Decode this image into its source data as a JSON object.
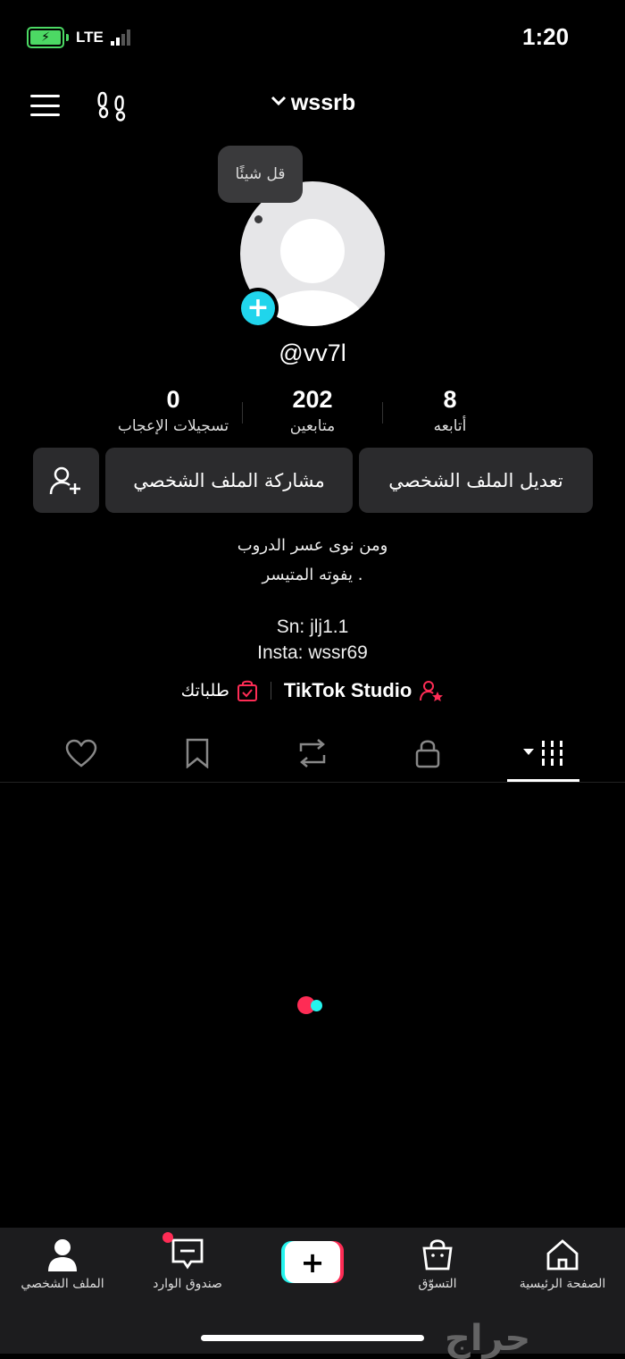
{
  "status_bar": {
    "time": "1:20",
    "network": "LTE",
    "battery_charging": true,
    "battery_color": "#4cd964"
  },
  "header": {
    "username": "wssrb",
    "menu_icon": "hamburger-icon",
    "footprints_icon": "footprints-icon",
    "dropdown_icon": "chevron-down-icon"
  },
  "profile": {
    "bubble_text": "قل شيئًا",
    "handle": "@vv7l",
    "add_icon": "plus-icon",
    "accent": "#20d5ec"
  },
  "stats": [
    {
      "value": "8",
      "label": "أتابعه"
    },
    {
      "value": "202",
      "label": "متابعين"
    },
    {
      "value": "0",
      "label": "تسجيلات الإعجاب"
    }
  ],
  "buttons": {
    "edit_profile": "تعديل الملف الشخصي",
    "share_profile": "مشاركة الملف الشخصي",
    "add_friend_icon": "add-user-icon"
  },
  "bio": {
    "line1": "ومن نوى عسر الدروب",
    "line2": "يفوته المتيسر .",
    "line3": "Sn: jlj1.1",
    "line4": "Insta: wssr69"
  },
  "links": {
    "studio": "TikTok Studio",
    "orders": "طلباتك",
    "link_color": "#fe2c55"
  },
  "tabs": [
    "videos-grid",
    "private-lock",
    "reposts",
    "favorites",
    "liked"
  ],
  "bottom_nav": {
    "home": "الصفحة الرئيسية",
    "shop": "التسوّق",
    "inbox": "صندوق الوارد",
    "profile": "الملف الشخصي"
  },
  "watermark": "حراج"
}
